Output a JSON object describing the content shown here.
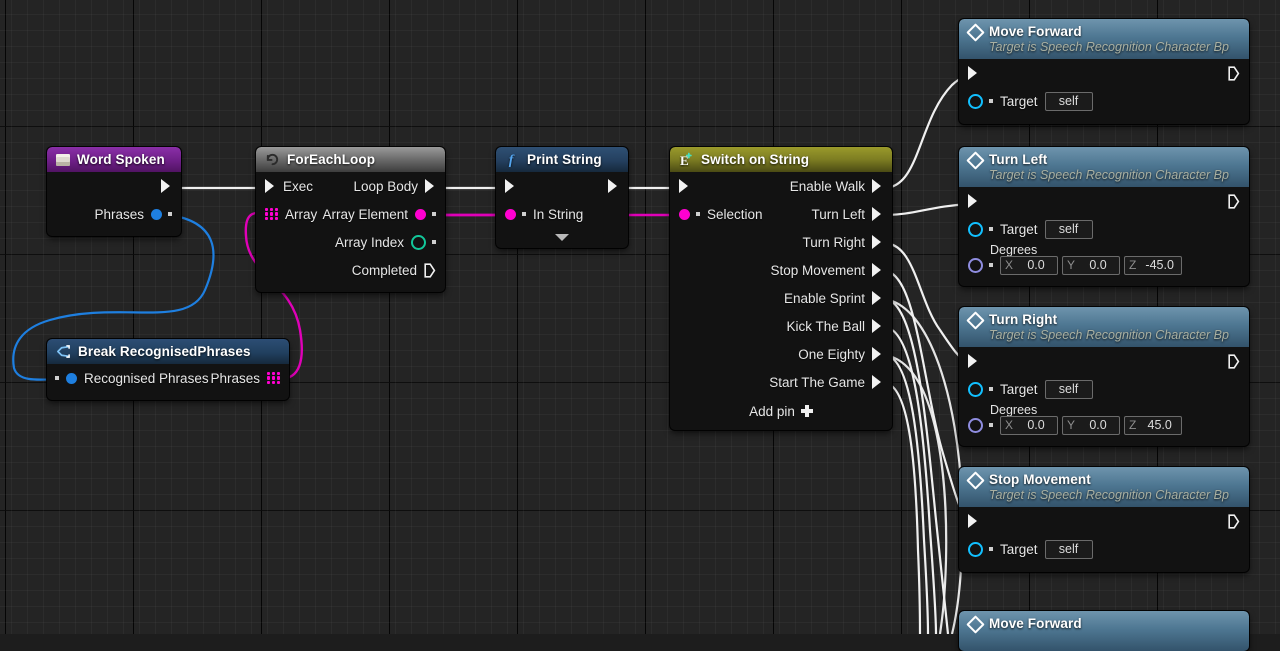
{
  "canvas": {
    "app": "Unreal Engine Blueprint Editor",
    "background_color": "#242424",
    "grid_minor_color": "#2b2b2b",
    "grid_major_color": "#0a0a0a"
  },
  "wire_colors": {
    "exec": "#f0f0f0",
    "string": "#ff00d0",
    "struct": "#1e7fe0",
    "array_string": "#ff00d0"
  },
  "nodes": {
    "word_spoken": {
      "title": "Word Spoken",
      "icon": "event-icon",
      "header_color": "#6e1f87",
      "out_exec": "",
      "out_data_label": "Phrases"
    },
    "break_recognised": {
      "title": "Break RecognisedPhrases",
      "icon": "break-struct-icon",
      "header_color": "#23406a",
      "in_label": "Recognised Phrases",
      "out_label": "Phrases"
    },
    "for_each_loop": {
      "title": "ForEachLoop",
      "icon": "loop-icon",
      "header_color": "#6f6f6f",
      "in_exec": "Exec",
      "in_array": "Array",
      "out_loop_body": "Loop Body",
      "out_array_element": "Array Element",
      "out_array_index": "Array Index",
      "out_completed": "Completed"
    },
    "print_string": {
      "title": "Print String",
      "icon": "function-f-icon",
      "header_color": "#24405f",
      "in_string": "In String",
      "expand": "expand-caret-icon"
    },
    "switch_on_string": {
      "title": "Switch on String",
      "icon": "enum-plus-icon",
      "header_color": "#7d7d22",
      "in_selection": "Selection",
      "add_pin": "Add pin",
      "cases": [
        "Enable Walk",
        "Turn Left",
        "Turn Right",
        "Stop Movement",
        "Enable Sprint",
        "Kick The Ball",
        "One Eighty",
        "Start The Game"
      ]
    },
    "move_forward_1": {
      "title": "Move Forward",
      "subtitle": "Target is Speech Recognition Character Bp",
      "icon": "diamond-icon",
      "target_label": "Target",
      "target_value": "self"
    },
    "turn_left": {
      "title": "Turn Left",
      "subtitle": "Target is Speech Recognition Character Bp",
      "icon": "diamond-icon",
      "target_label": "Target",
      "target_value": "self",
      "degrees_label": "Degrees",
      "degrees": {
        "x_axis": "X",
        "x": "0.0",
        "y_axis": "Y",
        "y": "0.0",
        "z_axis": "Z",
        "z": "-45.0"
      }
    },
    "turn_right": {
      "title": "Turn Right",
      "subtitle": "Target is Speech Recognition Character Bp",
      "icon": "diamond-icon",
      "target_label": "Target",
      "target_value": "self",
      "degrees_label": "Degrees",
      "degrees": {
        "x_axis": "X",
        "x": "0.0",
        "y_axis": "Y",
        "y": "0.0",
        "z_axis": "Z",
        "z": "45.0"
      }
    },
    "stop_movement": {
      "title": "Stop Movement",
      "subtitle": "Target is Speech Recognition Character Bp",
      "icon": "diamond-icon",
      "target_label": "Target",
      "target_value": "self"
    },
    "move_forward_2": {
      "title": "Move Forward",
      "icon": "diamond-icon"
    }
  }
}
